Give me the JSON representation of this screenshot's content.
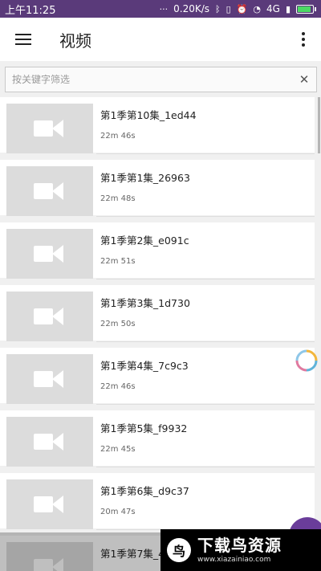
{
  "status_bar": {
    "time": "上午11:25",
    "more": "···",
    "speed": "0.20K/s",
    "network": "4G"
  },
  "app_bar": {
    "title": "视频"
  },
  "search": {
    "placeholder": "按关键字筛选",
    "clear_glyph": "✕"
  },
  "videos": [
    {
      "name": "第1季第10集_1ed44",
      "duration": "22m 46s"
    },
    {
      "name": "第1季第1集_26963",
      "duration": "22m 48s"
    },
    {
      "name": "第1季第2集_e091c",
      "duration": "22m 51s"
    },
    {
      "name": "第1季第3集_1d730",
      "duration": "22m 50s"
    },
    {
      "name": "第1季第4集_7c9c3",
      "duration": "22m 46s"
    },
    {
      "name": "第1季第5集_f9932",
      "duration": "22m 45s"
    },
    {
      "name": "第1季第6集_d9c37",
      "duration": "20m 47s"
    },
    {
      "name": "第1季第7集_4",
      "duration": ""
    }
  ],
  "watermark": {
    "badge": "鸟",
    "brand": "下载鸟资源",
    "url": "www.xiazainiao.com"
  },
  "colors": {
    "status_bar": "#5a3a7a",
    "thumb_bg": "#dcdcdc",
    "fab": "#6a3d9a"
  }
}
